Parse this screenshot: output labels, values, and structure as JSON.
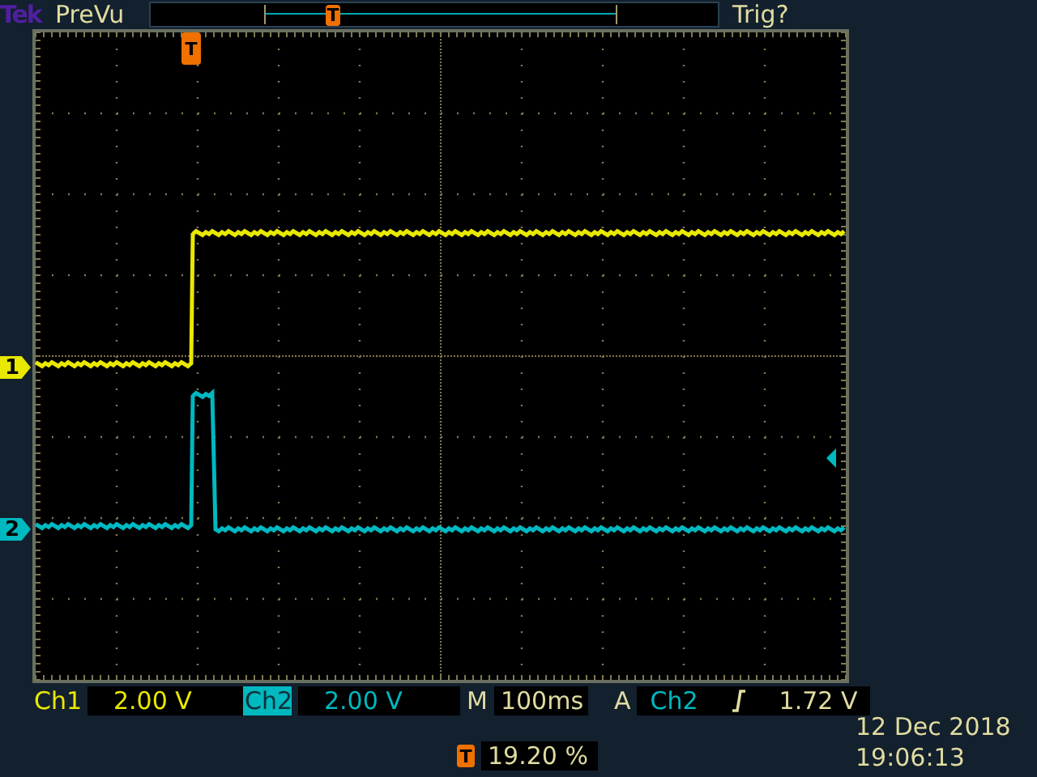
{
  "header": {
    "brand": "Tek",
    "mode": "PreVu",
    "record_marker": "T",
    "status": "Trig?"
  },
  "graticule": {
    "trigger_marker": "T",
    "channel_markers": [
      {
        "label": "1",
        "color": "#e8e800"
      },
      {
        "label": "2",
        "color": "#00b8c0"
      }
    ]
  },
  "channels": [
    {
      "label": "Ch1",
      "scale": "2.00 V",
      "selected": false
    },
    {
      "label": "Ch2",
      "scale": "2.00 V",
      "selected": true
    }
  ],
  "timebase": {
    "label": "M",
    "value": "100ms"
  },
  "trigger": {
    "label": "A",
    "source": "Ch2",
    "level": "1.72 V"
  },
  "trigger_position": {
    "marker": "T",
    "value": "19.20 %"
  },
  "date": "12 Dec 2018",
  "time": "19:06:13"
}
